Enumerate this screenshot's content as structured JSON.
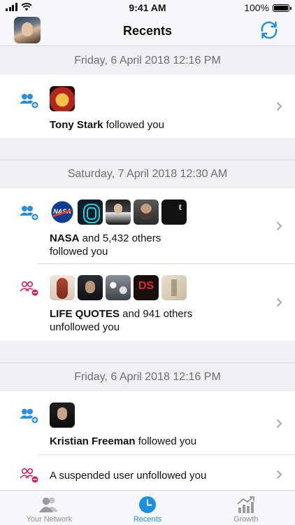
{
  "status_bar": {
    "time": "9:41 AM",
    "battery": "100%",
    "battery_level": 1.0
  },
  "nav": {
    "title": "Recents"
  },
  "sections": [
    {
      "header": "Friday, 6 April 2018 12:16 PM",
      "rows": [
        {
          "type": "follow",
          "bold": "Tony Stark",
          "text": " followed you",
          "line2": ""
        }
      ]
    },
    {
      "header": "Saturday, 7 April 2018 12:30 AM",
      "rows": [
        {
          "type": "follow",
          "bold": "NASA",
          "text": " and 5,432 others",
          "line2": "followed you"
        },
        {
          "type": "unfollow",
          "bold": "LIFE QUOTES",
          "text": " and 941 others",
          "line2": "unfollowed you"
        }
      ]
    },
    {
      "header": "Friday, 6 April 2018 12:16 PM",
      "rows": [
        {
          "type": "follow",
          "bold": "Kristian Freeman",
          "text": " followed you",
          "line2": ""
        },
        {
          "type": "unfollow",
          "bold": "",
          "text": "A suspended user unfollowed you",
          "line2": ""
        }
      ]
    }
  ],
  "nasa_avatar_text": "NASA",
  "tumblr_avatar_text": "t",
  "ds_avatar_text": "DS",
  "tabs": [
    {
      "label": "Your Network",
      "icon": "people-icon",
      "active": false
    },
    {
      "label": "Recents",
      "icon": "clock-icon",
      "active": true
    },
    {
      "label": "Growth",
      "icon": "growth-chart-icon",
      "active": false
    }
  ],
  "colors": {
    "accent": "#1b8fe6",
    "follow": "#2d8ee0",
    "unfollow": "#d1205b",
    "inactive": "#8e8e93"
  }
}
